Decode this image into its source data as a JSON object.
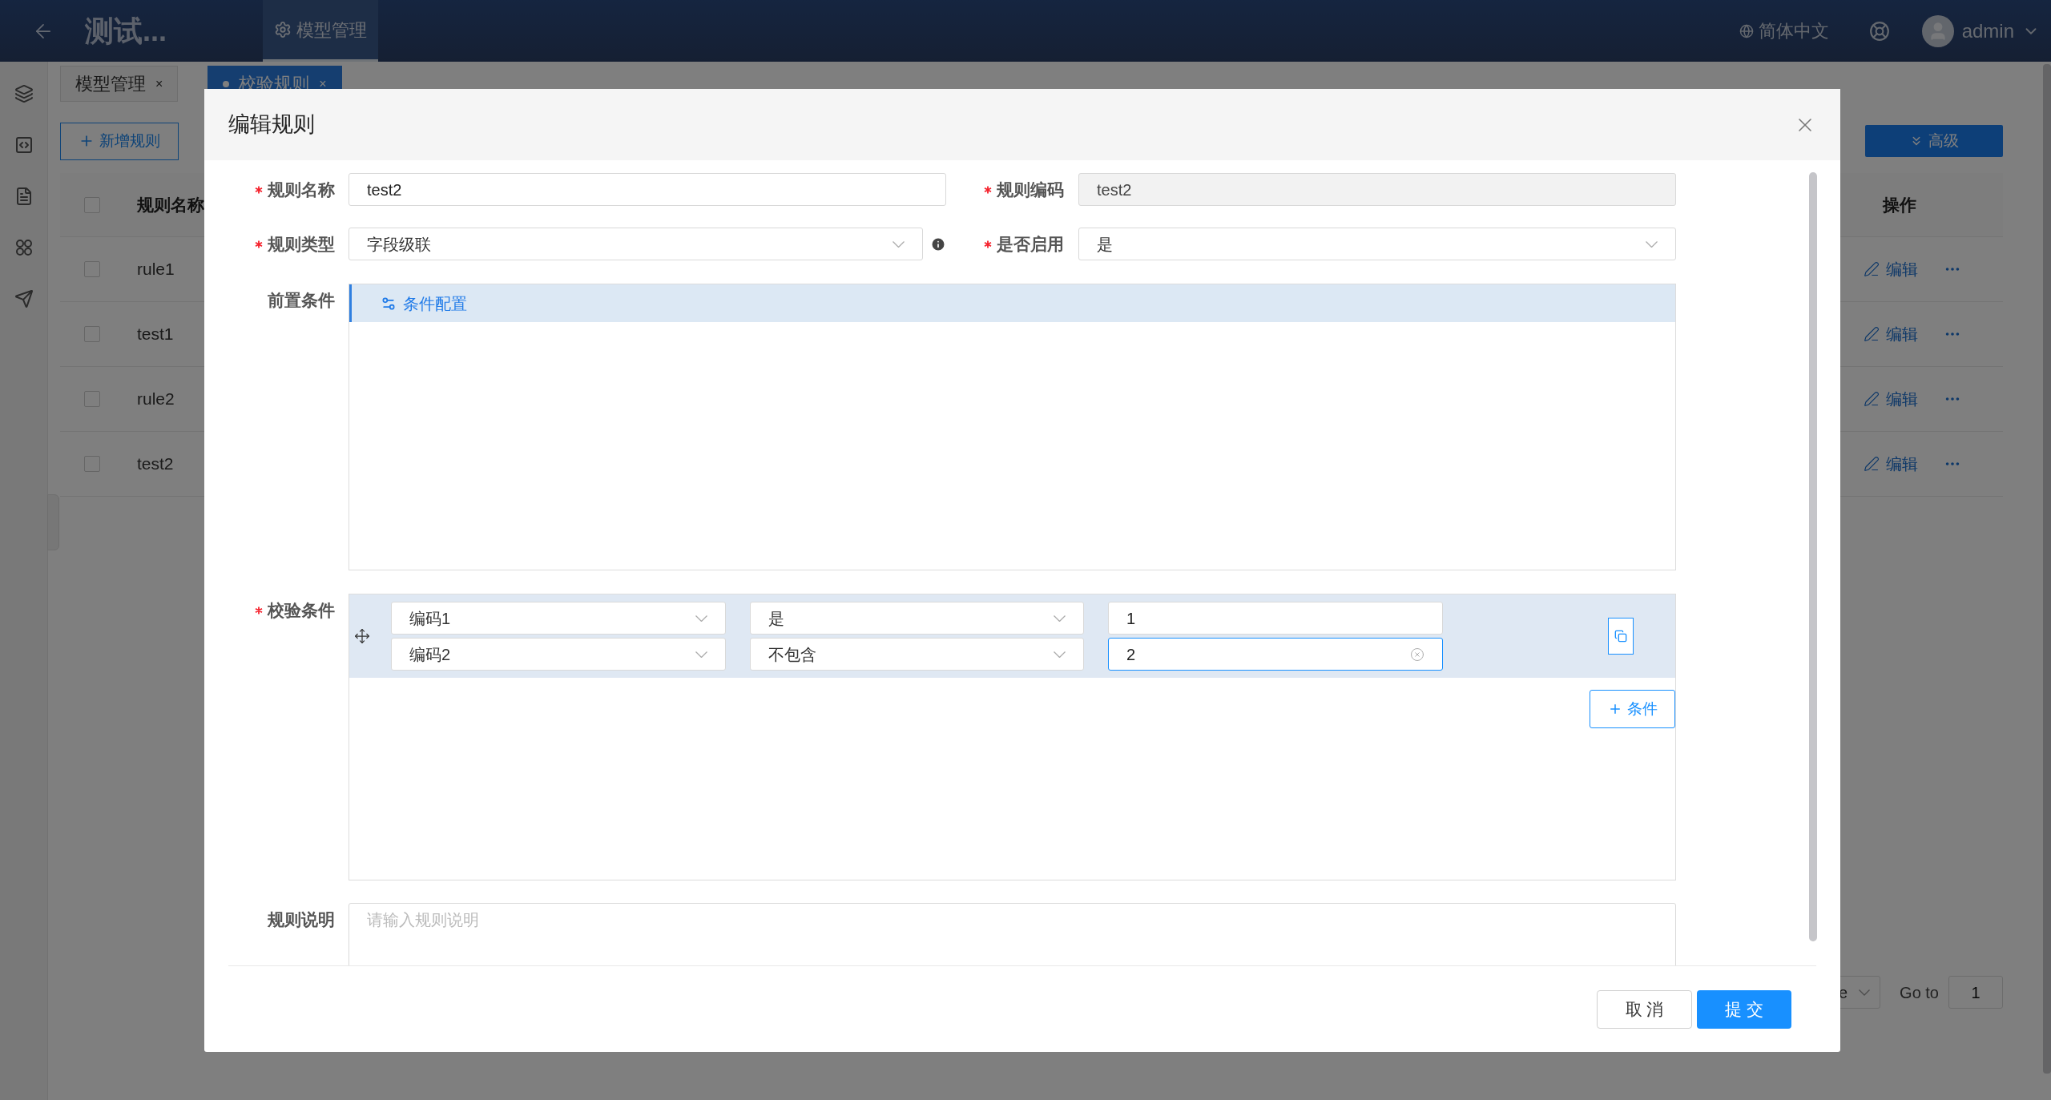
{
  "header": {
    "title": "测试...",
    "nav": [
      {
        "label": "模型管理",
        "selected": true
      }
    ],
    "language": "简体中文",
    "user": "admin"
  },
  "tabs": [
    {
      "label": "模型管理",
      "close": "×",
      "selected": false
    },
    {
      "label": "校验规则",
      "close": "×",
      "selected": true
    }
  ],
  "toolbar": {
    "add_button": "新增规则",
    "advanced_button": "高级"
  },
  "table": {
    "columns": [
      "规则名称",
      "操作"
    ],
    "all_checked": false,
    "rows": [
      {
        "name": "rule1",
        "edit": "编辑",
        "checked": false
      },
      {
        "name": "test1",
        "edit": "编辑",
        "checked": false
      },
      {
        "name": "rule2",
        "edit": "编辑",
        "checked": false
      },
      {
        "name": "test2",
        "edit": "编辑",
        "checked": false
      }
    ]
  },
  "pagination": {
    "page_size": "e",
    "goto_label": "Go to",
    "page": "1"
  },
  "dialog": {
    "title": "编辑规则",
    "name": {
      "label": "规则名称",
      "required": true,
      "value": "test2"
    },
    "code": {
      "label": "规则编码",
      "required": true,
      "value": "test2",
      "disabled": true
    },
    "type": {
      "label": "规则类型",
      "required": true,
      "value": "字段级联"
    },
    "enabled": {
      "label": "是否启用",
      "required": true,
      "value": "是"
    },
    "precondition": {
      "label": "前置条件",
      "required": false,
      "config_button": "条件配置"
    },
    "check": {
      "label": "校验条件",
      "required": true,
      "add_button": "条件",
      "rows": [
        {
          "field": "编码1",
          "operator": "是",
          "value": "1",
          "focused": false
        },
        {
          "field": "编码2",
          "operator": "不包含",
          "value": "2",
          "focused": true
        }
      ]
    },
    "description": {
      "label": "规则说明",
      "required": false,
      "placeholder": "请输入规则说明"
    },
    "buttons": {
      "cancel": "取 消",
      "submit": "提 交"
    }
  }
}
